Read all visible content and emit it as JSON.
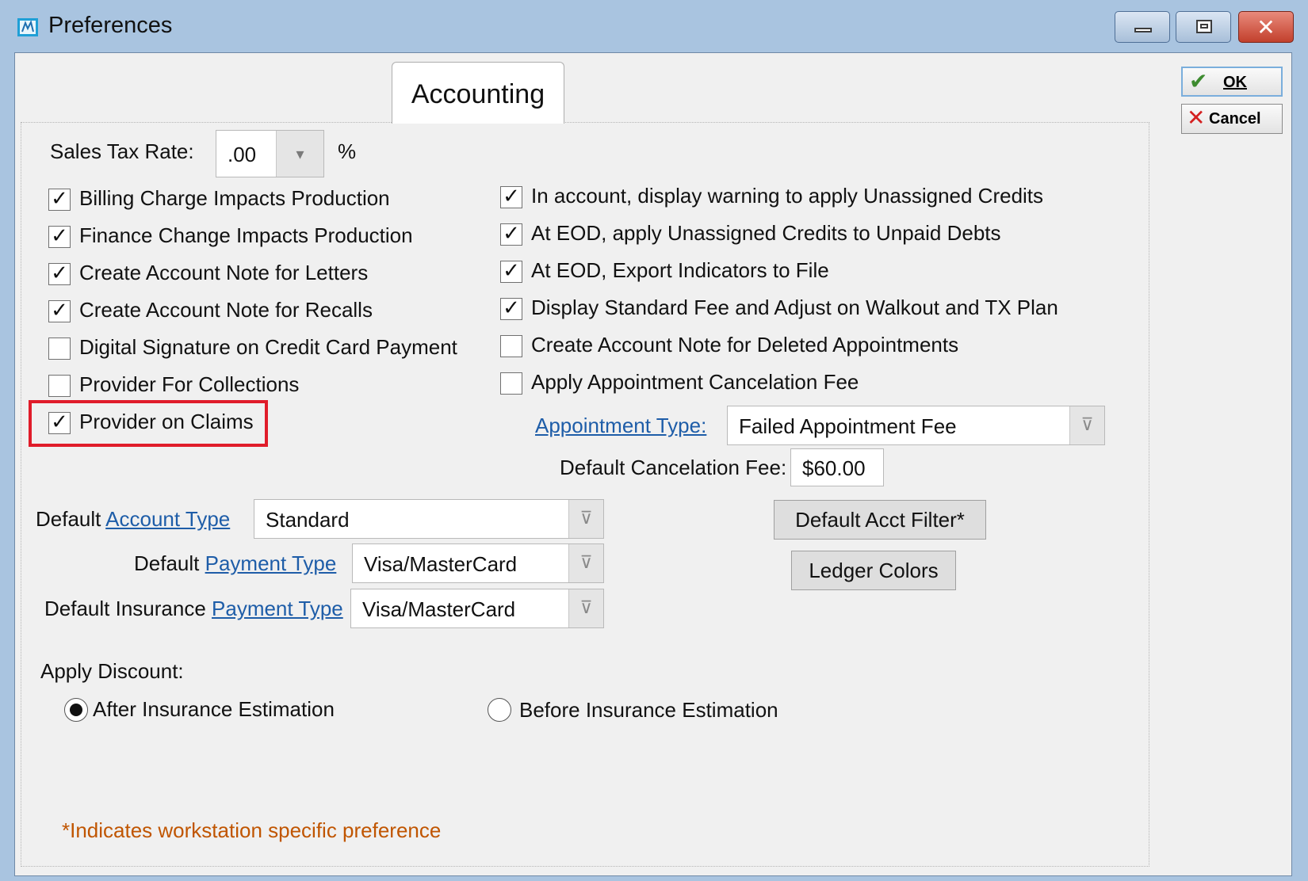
{
  "window": {
    "title": "Preferences",
    "minimize_icon": "minimize-icon",
    "maximize_icon": "maximize-icon",
    "close_icon": "close-icon",
    "close_glyph": "✕"
  },
  "tabs": [
    {
      "label": "Accounting",
      "active": true
    }
  ],
  "buttons": {
    "ok": {
      "label": "OK",
      "icon": "checkmark-icon",
      "glyph": "✔"
    },
    "cancel": {
      "label": "Cancel",
      "icon": "x-icon",
      "glyph": "✕"
    }
  },
  "sales_tax": {
    "label": "Sales Tax Rate:",
    "value": ".00",
    "unit": "%",
    "arrow": "▾"
  },
  "checkboxes_left": [
    {
      "label": "Billing Charge Impacts Production",
      "checked": true
    },
    {
      "label": "Finance Change Impacts Production",
      "checked": true
    },
    {
      "label": "Create Account Note for Letters",
      "checked": true
    },
    {
      "label": "Create Account Note for Recalls",
      "checked": true
    },
    {
      "label": "Digital Signature on Credit Card Payment",
      "checked": false
    },
    {
      "label": "Provider For Collections",
      "checked": false
    },
    {
      "label": "Provider on Claims",
      "checked": true
    }
  ],
  "checkboxes_right": [
    {
      "label": "In account, display warning to apply Unassigned Credits",
      "checked": true
    },
    {
      "label": "At EOD, apply Unassigned Credits to Unpaid Debts",
      "checked": true
    },
    {
      "label": "At EOD, Export Indicators to File",
      "checked": true
    },
    {
      "label": "Display Standard Fee and Adjust on Walkout and TX Plan",
      "checked": true
    },
    {
      "label": "Create Account Note for Deleted Appointments",
      "checked": false
    },
    {
      "label": "Apply Appointment Cancelation Fee",
      "checked": false
    }
  ],
  "check_glyph": "✓",
  "dropdown_glyph": "⊽",
  "appointment_type": {
    "label": "Appointment Type:",
    "value": "Failed Appointment Fee"
  },
  "cancel_fee": {
    "label": "Default Cancelation Fee:",
    "value": "$60.00"
  },
  "account_type": {
    "prefix": "Default ",
    "link": "Account Type",
    "value": "Standard"
  },
  "payment_type": {
    "prefix": "Default ",
    "link": "Payment Type",
    "value": "Visa/MasterCard"
  },
  "insurance_payment_type": {
    "prefix": "Default Insurance ",
    "link": "Payment Type",
    "value": "Visa/MasterCard"
  },
  "action_buttons": {
    "acct_filter": "Default Acct Filter*",
    "ledger_colors": "Ledger Colors"
  },
  "discount": {
    "label": "Apply Discount:",
    "options": [
      {
        "label": "After Insurance Estimation",
        "selected": true
      },
      {
        "label": "Before Insurance Estimation",
        "selected": false
      }
    ]
  },
  "footnote": "*Indicates workstation specific preference",
  "colors": {
    "highlight": "#e01c2a",
    "footnote": "#c05500",
    "link": "#1e5da8",
    "titlebar": "#a9c4e0"
  }
}
